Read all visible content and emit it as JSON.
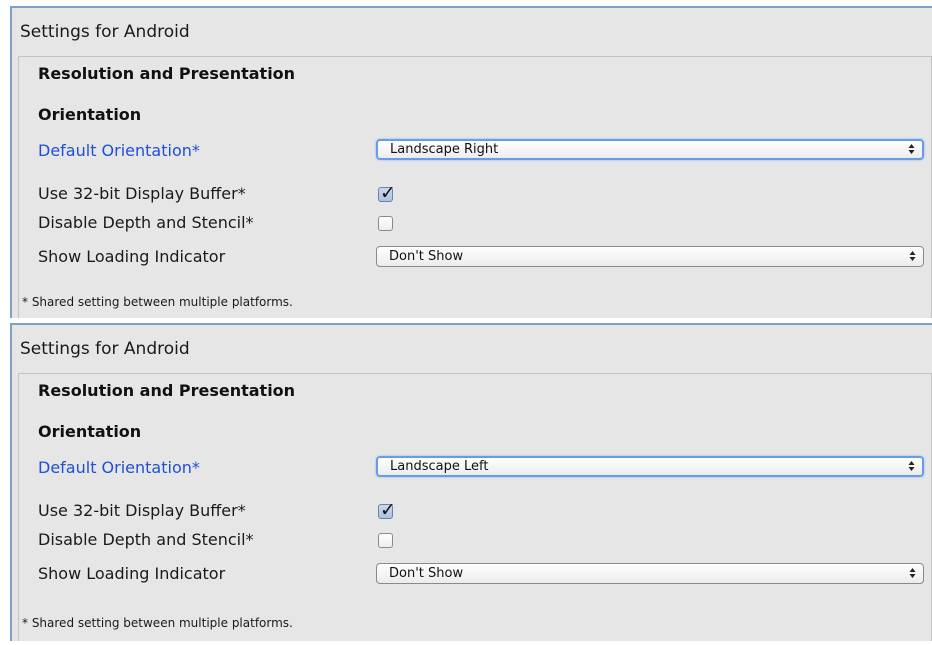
{
  "panels": [
    {
      "title": "Settings for Android",
      "section": "Resolution and Presentation",
      "group": "Orientation",
      "default_orientation": {
        "label": "Default Orientation*",
        "value": "Landscape Right"
      },
      "use_32bit_buffer": {
        "label": "Use 32-bit Display Buffer*",
        "checked": true
      },
      "disable_depth_stencil": {
        "label": "Disable Depth and Stencil*",
        "checked": false
      },
      "show_loading_indicator": {
        "label": "Show Loading Indicator",
        "value": "Don't Show"
      },
      "footnote": "* Shared setting between multiple platforms."
    },
    {
      "title": "Settings for Android",
      "section": "Resolution and Presentation",
      "group": "Orientation",
      "default_orientation": {
        "label": "Default Orientation*",
        "value": "Landscape Left"
      },
      "use_32bit_buffer": {
        "label": "Use 32-bit Display Buffer*",
        "checked": true
      },
      "disable_depth_stencil": {
        "label": "Disable Depth and Stencil*",
        "checked": false
      },
      "show_loading_indicator": {
        "label": "Show Loading Indicator",
        "value": "Don't Show"
      },
      "footnote": "* Shared setting between multiple platforms."
    }
  ],
  "icons": {
    "dropdown_arrow": "up-down-arrows-icon",
    "checkmark": "checkmark-icon"
  },
  "colors": {
    "accent_label": "#1f4fd8",
    "focus_ring": "#6a9be6",
    "panel_bg": "#e6e6e6"
  }
}
